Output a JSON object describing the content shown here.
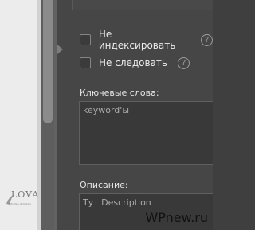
{
  "settings": {
    "noindex_label": "Не индексировать",
    "nofollow_label": "Не следовать",
    "help_symbol": "?",
    "keywords": {
      "label": "Ключевые слова:",
      "value": "keyword'ы"
    },
    "description": {
      "label": "Описание:",
      "value": "Тут Description"
    }
  },
  "preview": {
    "logo_text": "LOVA",
    "logo_subtext": "Hidden of Dignity"
  },
  "watermark": "WPnew.ru",
  "colors": {
    "panel": "#464646",
    "text": "#ececec",
    "field_bg": "#393939",
    "field_text": "#a9a9a9"
  }
}
